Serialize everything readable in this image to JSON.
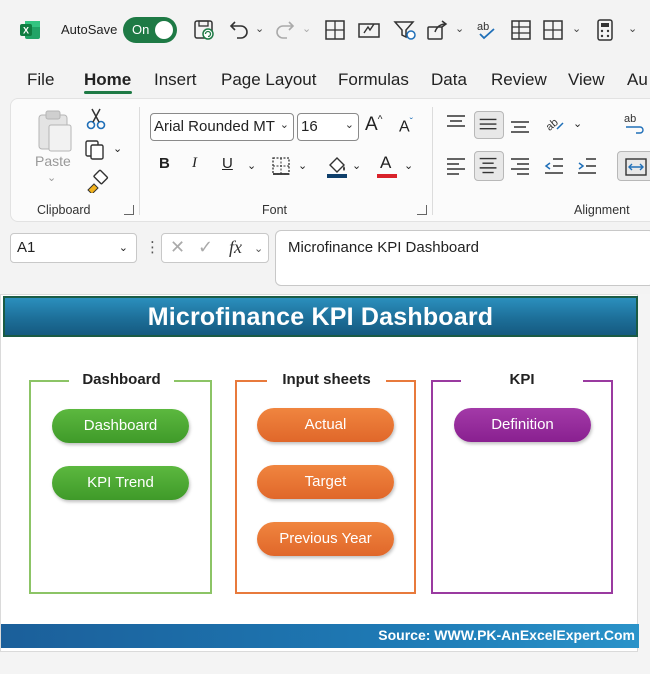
{
  "app": {
    "autosave_label": "AutoSave",
    "autosave_state": "On"
  },
  "tabs": [
    "File",
    "Home",
    "Insert",
    "Page Layout",
    "Formulas",
    "Data",
    "Review",
    "View",
    "Au"
  ],
  "active_tab": "Home",
  "ribbon": {
    "clipboard": {
      "label": "Clipboard",
      "paste_label": "Paste"
    },
    "font": {
      "label": "Font",
      "font_name": "Arial Rounded MT",
      "font_size": "16",
      "bold": "B",
      "italic": "I",
      "underline": "U",
      "font_color_letter": "A"
    },
    "alignment": {
      "label": "Alignment"
    }
  },
  "formula_bar": {
    "name_box": "A1",
    "fx": "fx",
    "formula": "Microfinance KPI Dashboard"
  },
  "sheet": {
    "title": "Microfinance KPI Dashboard",
    "footer": "Source: WWW.PK-AnExcelExpert.Com",
    "panels": [
      {
        "title": "Dashboard",
        "color": "#8cc466",
        "buttons": [
          "Dashboard",
          "KPI Trend"
        ]
      },
      {
        "title": "Input sheets",
        "color": "#e87a3c",
        "buttons": [
          "Actual",
          "Target",
          "Previous Year"
        ]
      },
      {
        "title": "KPI",
        "color": "#9a3aa0",
        "buttons": [
          "Definition"
        ]
      }
    ]
  },
  "colors": {
    "excel_green": "#1e7a45",
    "banner_blue": "#1d6f99",
    "pill_green": "#4aa832",
    "pill_orange": "#e8702f",
    "pill_purple": "#962a9c"
  },
  "icons": [
    "excel-logo-icon",
    "save-icon",
    "undo-icon",
    "redo-icon",
    "borders-icon",
    "form-icon",
    "filter-icon",
    "share-icon",
    "spelling-icon",
    "table-icon",
    "calculator-icon",
    "paste-icon",
    "cut-icon",
    "copy-icon",
    "format-painter-icon",
    "increase-font-icon",
    "decrease-font-icon",
    "border-icon",
    "fill-color-icon",
    "font-color-icon",
    "align-top-icon",
    "align-middle-icon",
    "align-bottom-icon",
    "orientation-icon",
    "align-left-icon",
    "align-center-icon",
    "align-right-icon",
    "decrease-indent-icon",
    "increase-indent-icon",
    "wrap-text-icon",
    "merge-icon"
  ]
}
